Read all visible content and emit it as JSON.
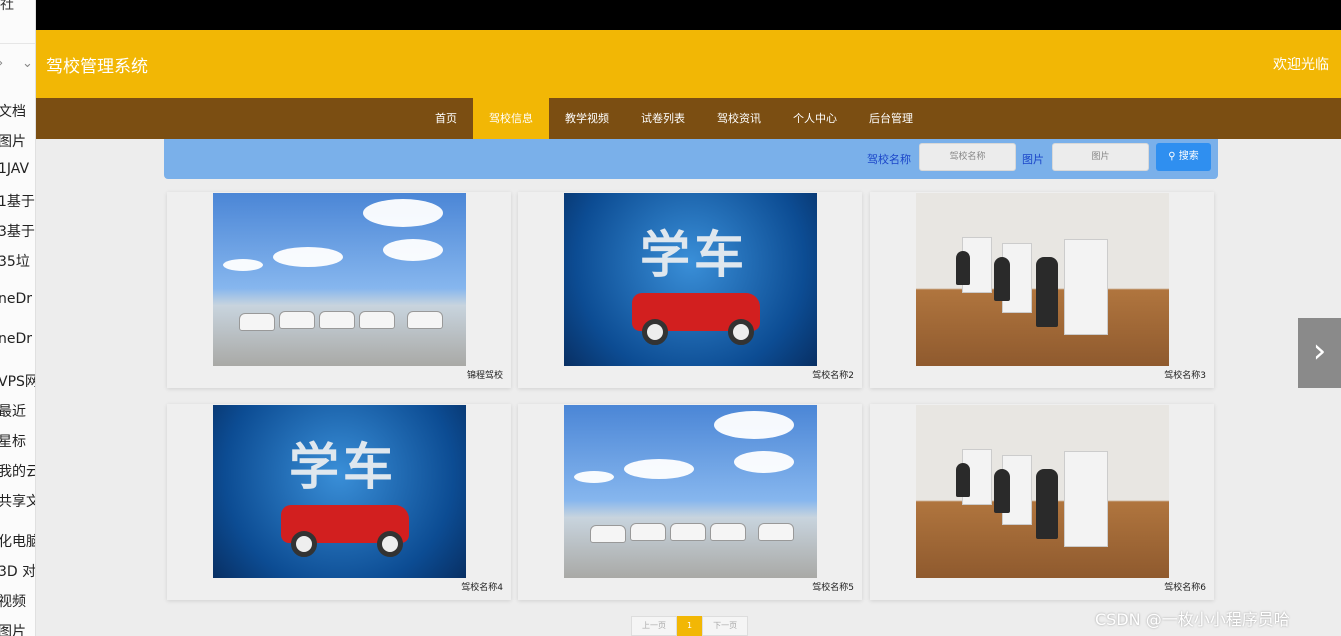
{
  "explorer": {
    "top_text": "社",
    "items": [
      "文档",
      "图片",
      "1JAV",
      "1基于",
      "3基于",
      "35垃",
      "neDr",
      "neDr",
      "VPS网",
      "最近",
      "星标",
      "我的云",
      "共享文",
      "化电脑",
      "3D 对",
      "视频",
      "图片"
    ]
  },
  "header": {
    "brand": "驾校管理系统",
    "welcome": "欢迎光临"
  },
  "nav": {
    "items": [
      "首页",
      "驾校信息",
      "教学视频",
      "试卷列表",
      "驾校资讯",
      "个人中心",
      "后台管理"
    ]
  },
  "search": {
    "label_name": "驾校名称",
    "placeholder_name": "驾校名称",
    "label_image": "图片",
    "placeholder_image": "图片",
    "button": "搜索"
  },
  "cards": [
    {
      "caption": "锦程驾校",
      "image": "parking-lot-cars"
    },
    {
      "caption": "驾校名称2",
      "image": "xueche-poster"
    },
    {
      "caption": "驾校名称3",
      "image": "simulator-room"
    },
    {
      "caption": "驾校名称4",
      "image": "xueche-poster"
    },
    {
      "caption": "驾校名称5",
      "image": "parking-lot-cars"
    },
    {
      "caption": "驾校名称6",
      "image": "simulator-room"
    }
  ],
  "poster_text": "学车",
  "pager": {
    "prev": "上一页",
    "current": "1",
    "next": "下一页"
  },
  "next_arrow": "›",
  "watermark": "CSDN @一枚小小程序员哈",
  "colors": {
    "header": "#f2b705",
    "nav": "#7b4e12",
    "search": "#7ab0ea"
  }
}
